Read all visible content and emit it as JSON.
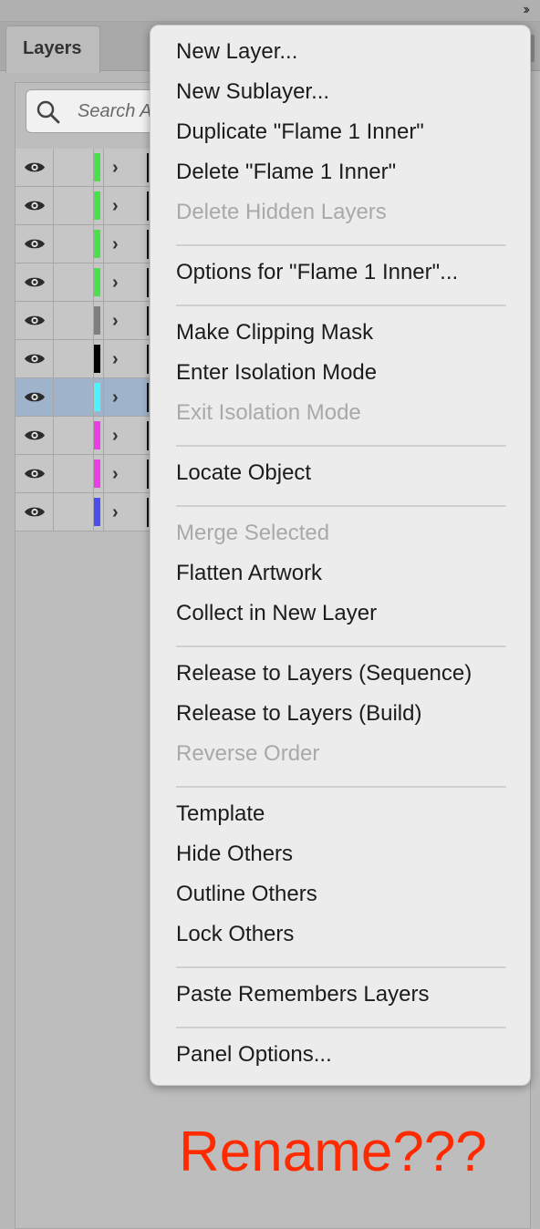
{
  "window": {
    "collapse_glyph": "››"
  },
  "panel": {
    "tab_label": "Layers",
    "search_placeholder": "Search All",
    "search_value": ""
  },
  "layers": [
    {
      "color": "#4be04b",
      "visible": true,
      "selected": false
    },
    {
      "color": "#4be04b",
      "visible": true,
      "selected": false
    },
    {
      "color": "#4be04b",
      "visible": true,
      "selected": false
    },
    {
      "color": "#4be04b",
      "visible": true,
      "selected": false
    },
    {
      "color": "#7f7f7f",
      "visible": true,
      "selected": false
    },
    {
      "color": "#000000",
      "visible": true,
      "selected": false
    },
    {
      "color": "#4df4ff",
      "visible": true,
      "selected": true
    },
    {
      "color": "#ea3fe6",
      "visible": true,
      "selected": false
    },
    {
      "color": "#ea3fe6",
      "visible": true,
      "selected": false
    },
    {
      "color": "#4a4ef0",
      "visible": true,
      "selected": false
    }
  ],
  "context_menu": {
    "items": [
      {
        "label": "New Layer...",
        "enabled": true
      },
      {
        "label": "New Sublayer...",
        "enabled": true
      },
      {
        "label": "Duplicate \"Flame 1 Inner\"",
        "enabled": true
      },
      {
        "label": "Delete \"Flame 1 Inner\"",
        "enabled": true
      },
      {
        "label": "Delete Hidden Layers",
        "enabled": false
      },
      {
        "label": "Options for \"Flame 1 Inner\"...",
        "enabled": true
      },
      {
        "label": "Make Clipping Mask",
        "enabled": true
      },
      {
        "label": "Enter Isolation Mode",
        "enabled": true
      },
      {
        "label": "Exit Isolation Mode",
        "enabled": false
      },
      {
        "label": "Locate Object",
        "enabled": true
      },
      {
        "label": "Merge Selected",
        "enabled": false
      },
      {
        "label": "Flatten Artwork",
        "enabled": true
      },
      {
        "label": "Collect in New Layer",
        "enabled": true
      },
      {
        "label": "Release to Layers (Sequence)",
        "enabled": true
      },
      {
        "label": "Release to Layers (Build)",
        "enabled": true
      },
      {
        "label": "Reverse Order",
        "enabled": false
      },
      {
        "label": "Template",
        "enabled": true
      },
      {
        "label": "Hide Others",
        "enabled": true
      },
      {
        "label": "Outline Others",
        "enabled": true
      },
      {
        "label": "Lock Others",
        "enabled": true
      },
      {
        "label": "Paste Remembers Layers",
        "enabled": true
      },
      {
        "label": "Panel Options...",
        "enabled": true
      }
    ]
  },
  "annotation": {
    "text": "Rename???",
    "color": "#ff2a00"
  }
}
